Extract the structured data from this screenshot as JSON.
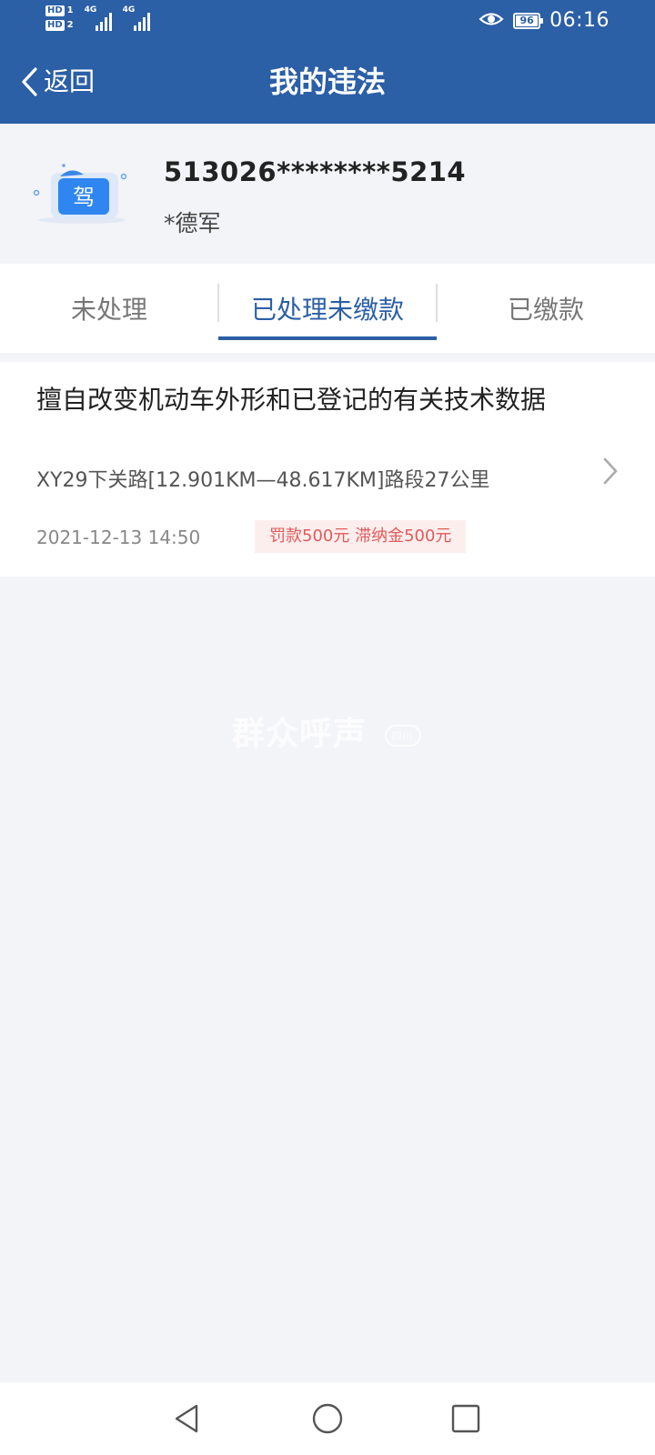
{
  "status_bar": {
    "hd1": "HD",
    "hd1_num": "1",
    "hd2": "HD",
    "hd2_num": "2",
    "network1": "4G",
    "network2": "4G",
    "battery": "96",
    "time": "06:16"
  },
  "header": {
    "back_label": "返回",
    "title": "我的违法"
  },
  "profile": {
    "icon_char": "驾",
    "id_number": "513026********5214",
    "name": "*德军"
  },
  "tabs": [
    {
      "label": "未处理",
      "active": false
    },
    {
      "label": "已处理未缴款",
      "active": true
    },
    {
      "label": "已缴款",
      "active": false
    }
  ],
  "violations": [
    {
      "title": "擅自改变机动车外形和已登记的有关技术数据",
      "location": "XY29下关路[12.901KM—48.617KM]路段27公里",
      "time": "2021-12-13 14:50",
      "fine": "罚款500元 滞纳金500元"
    }
  ],
  "watermark": {
    "text": "群众呼声",
    "badge": "四川"
  },
  "colors": {
    "brand": "#2b5fa6",
    "fine_text": "#e15a5a",
    "fine_bg": "#fdeeee",
    "background": "#f3f4f8"
  }
}
